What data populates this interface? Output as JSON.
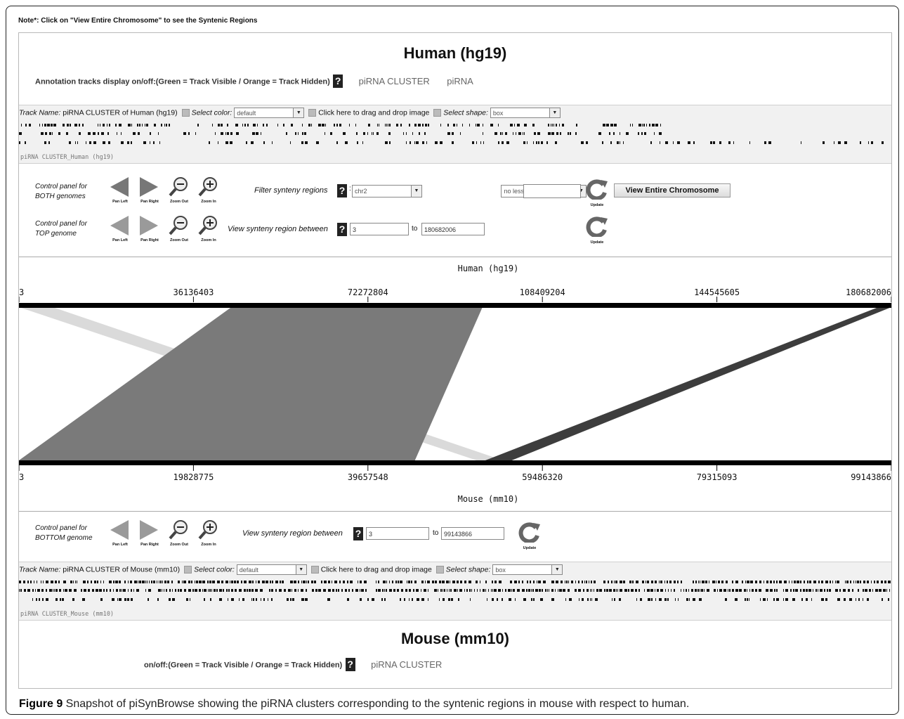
{
  "note": "Note*: Click on \"View Entire Chromosome\" to see the Syntenic Regions",
  "top": {
    "title": "Human (hg19)",
    "annotation_prefix": "Annotation tracks display on/off:(Green = Track Visible / ",
    "annotation_orange": "Orange = Track Hidden)",
    "help": "?",
    "tracks": [
      "piRNA CLUSTER",
      "piRNA"
    ],
    "track_bar": {
      "name_label": "Track Name:",
      "name_value": "piRNA CLUSTER of Human (hg19)",
      "color_label": "Select color:",
      "color_value": "default",
      "drag_label": "Click here to drag and drop image",
      "shape_label": "Select shape:",
      "shape_value": "box",
      "track_id": "piRNA CLUSTER_Human (hg19)"
    }
  },
  "control_both": {
    "label_line1": "Control panel for",
    "label_line2": "BOTH genomes",
    "nav": [
      "Pan Left",
      "Pan Right",
      "Zoom Out",
      "Zoom In"
    ],
    "filter_label": "Filter synteny regions",
    "chromosome": "chr2",
    "comparator": "no less than",
    "threshold": "",
    "update": "Update",
    "view_entire": "View Entire Chromosome"
  },
  "control_top": {
    "label_line1": "Control panel for",
    "label_line2": "TOP genome",
    "nav": [
      "Pan Left",
      "Pan Right",
      "Zoom Out",
      "Zoom In"
    ],
    "range_label": "View synteny region between",
    "from": "3",
    "to_label": "to",
    "to": "180682006",
    "update": "Update"
  },
  "chart_data": {
    "type": "synteny",
    "top_genome": "Human (hg19)",
    "top_ticks": [
      "3",
      "36136403",
      "72272804",
      "108409204",
      "144545605",
      "180682006"
    ],
    "top_range": [
      3,
      180682006
    ],
    "bottom_genome": "Mouse (mm10)",
    "bottom_ticks": [
      "3",
      "19828775",
      "39657548",
      "59486320",
      "79315093",
      "99143866"
    ],
    "bottom_range": [
      3,
      99143866
    ],
    "links": [
      {
        "top": [
          3,
          7000000
        ],
        "bottom": [
          52000000,
          55000000
        ],
        "color": "#dadada"
      },
      {
        "top": [
          44000000,
          96000000
        ],
        "bottom": [
          3,
          45000000
        ],
        "color": "#7a7a7a"
      },
      {
        "top": [
          178000000,
          180682006
        ],
        "bottom": [
          53000000,
          56000000
        ],
        "color": "#3d3d3d"
      }
    ]
  },
  "control_bottom": {
    "label_line1": "Control panel for",
    "label_line2": "BOTTOM genome",
    "nav": [
      "Pan Left",
      "Pan Right",
      "Zoom Out",
      "Zoom In"
    ],
    "range_label": "View synteny region between",
    "from": "3",
    "to_label": "to",
    "to": "99143866",
    "update": "Update"
  },
  "bottom": {
    "track_bar": {
      "name_label": "Track Name:",
      "name_value": "piRNA CLUSTER of Mouse (mm10)",
      "color_label": "Select color:",
      "color_value": "default",
      "drag_label": "Click here to drag and drop image",
      "shape_label": "Select shape:",
      "shape_value": "box",
      "track_id": "piRNA CLUSTER_Mouse (mm10)"
    },
    "title": "Mouse (mm10)",
    "annotation_prefix": "on/off:(Green = Track Visible / ",
    "annotation_orange": "Orange = Track Hidden)",
    "help": "?",
    "tracks": [
      "piRNA CLUSTER"
    ]
  },
  "caption": {
    "label": "Figure 9",
    "text": " Snapshot of piSynBrowse showing the piRNA clusters corresponding to the syntenic regions in mouse with respect to human."
  }
}
